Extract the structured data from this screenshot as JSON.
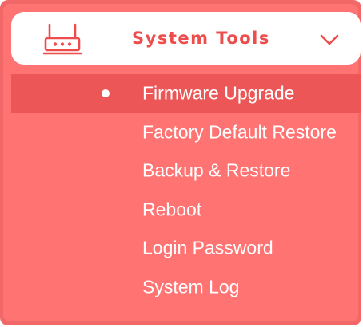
{
  "colors": {
    "accent": "#ee4d4d",
    "panel_border": "#f26767",
    "panel_background": "#ff7373",
    "active_item_background": "#ec5656",
    "header_background": "#ffffff",
    "text": "#ffffff"
  },
  "header": {
    "title": "System Tools",
    "icon": "router-icon",
    "toggle_icon": "chevron-down-icon",
    "expanded": true
  },
  "menu": {
    "items": [
      {
        "label": "Firmware Upgrade",
        "active": true
      },
      {
        "label": "Factory Default Restore",
        "active": false
      },
      {
        "label": "Backup & Restore",
        "active": false
      },
      {
        "label": "Reboot",
        "active": false
      },
      {
        "label": "Login Password",
        "active": false
      },
      {
        "label": "System Log",
        "active": false
      }
    ]
  }
}
